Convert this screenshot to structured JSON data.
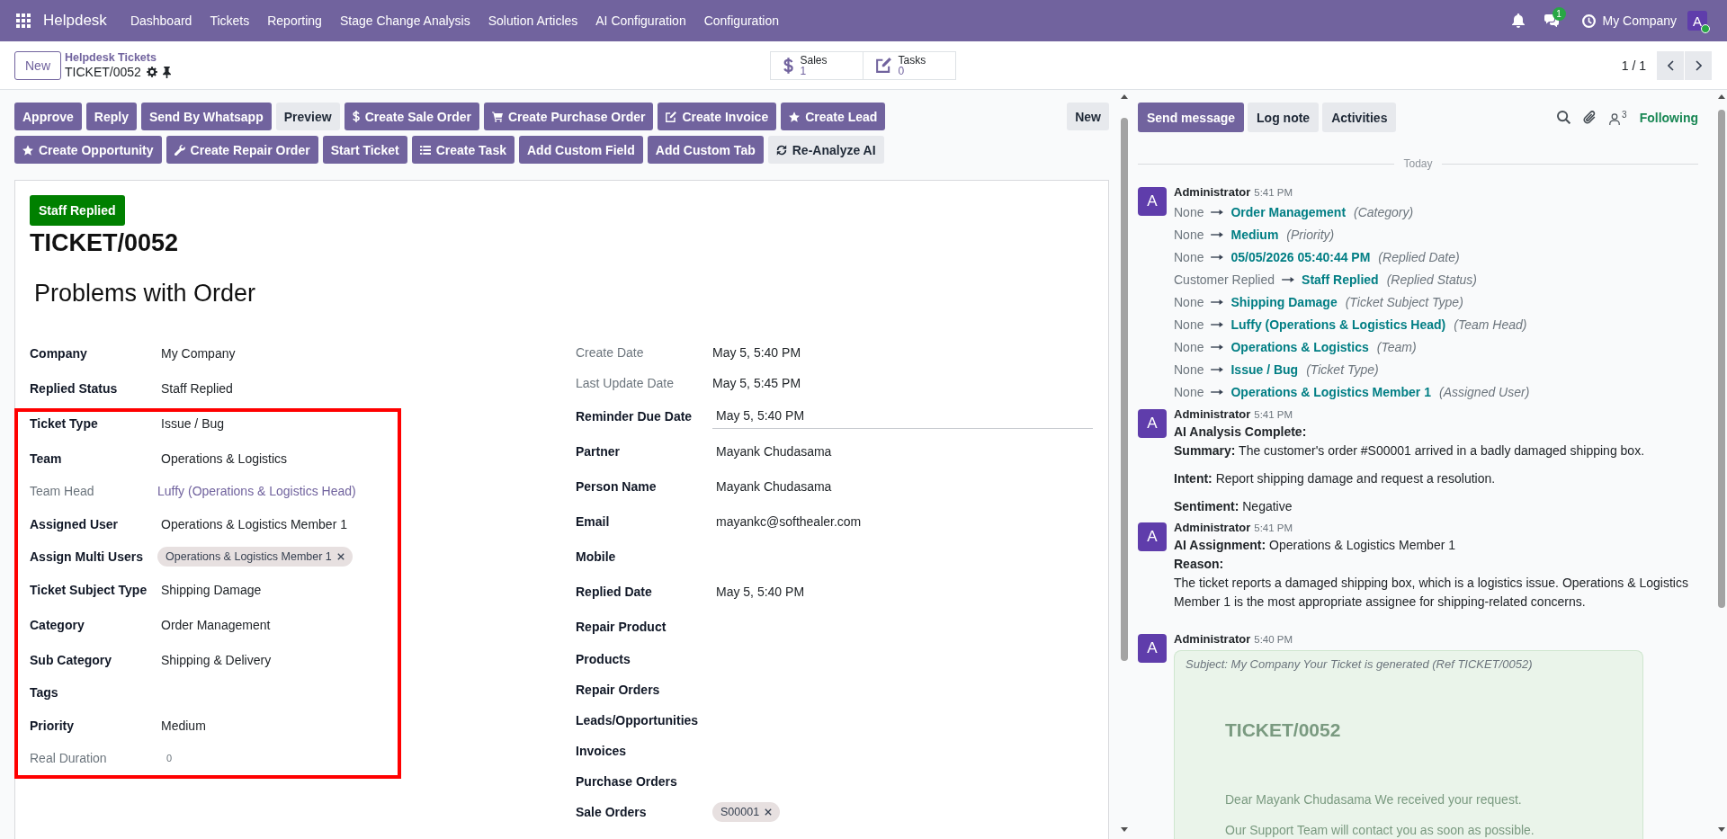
{
  "navbar": {
    "app_name": "Helpdesk",
    "menu": [
      "Dashboard",
      "Tickets",
      "Reporting",
      "Stage Change Analysis",
      "Solution Articles",
      "AI Configuration",
      "Configuration"
    ],
    "message_badge": "1",
    "company": "My Company",
    "avatar_letter": "A"
  },
  "control_panel": {
    "new_button": "New",
    "breadcrumb": "Helpdesk Tickets",
    "record_name": "TICKET/0052",
    "smart_buttons": [
      {
        "kind": "sales",
        "label": "Sales",
        "count": "1"
      },
      {
        "kind": "tasks",
        "label": "Tasks",
        "count": "0"
      }
    ],
    "pager": "1 / 1"
  },
  "action_buttons": {
    "top_row": [
      {
        "label": "Approve",
        "primary": true
      },
      {
        "label": "Reply",
        "primary": true
      },
      {
        "label": "Send By Whatsapp",
        "primary": true
      },
      {
        "label": "Preview",
        "primary": false
      },
      {
        "label": "Create Sale Order",
        "primary": true
      },
      {
        "label": "Create Purchase Order",
        "primary": true
      },
      {
        "label": "Create Invoice",
        "primary": true
      },
      {
        "label": "Create Lead",
        "primary": true
      }
    ],
    "bottom_row": [
      {
        "label": "Create Opportunity",
        "primary": true
      },
      {
        "label": "Create Repair Order",
        "primary": true
      },
      {
        "label": "Start Ticket",
        "primary": true
      },
      {
        "label": "Create Task",
        "primary": true
      },
      {
        "label": "Add Custom Field",
        "primary": true
      },
      {
        "label": "Add Custom Tab",
        "primary": true
      },
      {
        "label": "Re-Analyze AI",
        "primary": false
      }
    ],
    "side_button": {
      "label": "New",
      "primary": false
    }
  },
  "sheet": {
    "status_badge": "Staff Replied",
    "ticket_number": "TICKET/0052",
    "subject": "Problems with Order",
    "left_fields": [
      {
        "label": "Company",
        "value": "My Company",
        "kind": "text",
        "readonly": false,
        "focused": false
      },
      {
        "label": "Replied Status",
        "value": "Staff Replied",
        "kind": "text",
        "readonly": false,
        "focused": false
      }
    ],
    "highlighted_fields": [
      {
        "label": "Ticket Type",
        "value": "Issue / Bug",
        "kind": "text",
        "readonly": false,
        "focused": false
      },
      {
        "label": "Team",
        "value": "Operations & Logistics",
        "kind": "text",
        "readonly": false,
        "focused": false
      },
      {
        "label": "Team Head",
        "value": "Luffy (Operations & Logistics Head)",
        "kind": "link",
        "readonly": true,
        "focused": false
      },
      {
        "label": "Assigned User",
        "value": "Operations & Logistics Member 1",
        "kind": "text",
        "readonly": false,
        "focused": false
      },
      {
        "label": "Assign Multi Users",
        "tags": [
          "Operations & Logistics Member 1"
        ],
        "kind": "tags",
        "readonly": false,
        "focused": false
      },
      {
        "label": "Ticket Subject Type",
        "value": "Shipping Damage",
        "kind": "text",
        "readonly": false,
        "focused": false
      },
      {
        "label": "Category",
        "value": "Order Management",
        "kind": "text",
        "readonly": false,
        "focused": false
      },
      {
        "label": "Sub Category",
        "value": "Shipping & Delivery",
        "kind": "text",
        "readonly": false,
        "focused": false
      },
      {
        "label": "Tags",
        "kind": "tags",
        "readonly": false,
        "focused": false
      },
      {
        "label": "Priority",
        "value": "Medium",
        "kind": "text",
        "readonly": false,
        "focused": false
      },
      {
        "label": "Real Duration",
        "value": "0",
        "kind": "duration",
        "readonly": true,
        "focused": false
      }
    ],
    "right_fields": [
      {
        "label": "Create Date",
        "value": "May 5, 5:40 PM",
        "kind": "text",
        "readonly": true,
        "focused": false
      },
      {
        "label": "Last Update Date",
        "value": "May 5, 5:45 PM",
        "kind": "text",
        "readonly": true,
        "focused": false
      },
      {
        "label": "Reminder Due Date",
        "value": "May 5, 5:40 PM",
        "kind": "text",
        "readonly": false,
        "focused": true
      },
      {
        "label": "Partner",
        "value": "Mayank Chudasama",
        "kind": "text",
        "readonly": false,
        "focused": false
      },
      {
        "label": "Person Name",
        "value": "Mayank Chudasama",
        "kind": "text",
        "readonly": false,
        "focused": false
      },
      {
        "label": "Email",
        "value": "mayankc@softhealer.com",
        "kind": "text",
        "readonly": false,
        "focused": false
      },
      {
        "label": "Mobile",
        "kind": "text",
        "readonly": false,
        "focused": false
      },
      {
        "label": "Replied Date",
        "value": "May 5, 5:40 PM",
        "kind": "text",
        "readonly": false,
        "focused": false
      },
      {
        "label": "Repair Product",
        "kind": "text",
        "readonly": false,
        "focused": false
      },
      {
        "label": "Products",
        "kind": "tags",
        "readonly": false,
        "focused": false
      },
      {
        "label": "Repair Orders",
        "kind": "tags",
        "readonly": false,
        "focused": false
      },
      {
        "label": "Leads/Opportunities",
        "kind": "tags",
        "readonly": false,
        "focused": false
      },
      {
        "label": "Invoices",
        "kind": "tags",
        "readonly": false,
        "focused": false
      },
      {
        "label": "Purchase Orders",
        "kind": "tags",
        "readonly": false,
        "focused": false
      },
      {
        "label": "Sale Orders",
        "tags": [
          "S00001"
        ],
        "kind": "tags",
        "readonly": false,
        "focused": false
      }
    ]
  },
  "chatter": {
    "buttons": [
      {
        "label": "Send message",
        "primary": true
      },
      {
        "label": "Log note",
        "primary": false
      },
      {
        "label": "Activities",
        "primary": false
      }
    ],
    "follower_count": "3",
    "follow_label": "Following",
    "date_separator": "Today",
    "messages": [
      {
        "kind": "tracking",
        "avatar": "A",
        "author": "Administrator",
        "time": "5:41 PM",
        "changes": [
          {
            "old": "None",
            "new": "Order Management",
            "field": "(Category)"
          },
          {
            "old": "None",
            "new": "Medium",
            "field": "(Priority)"
          },
          {
            "old": "None",
            "new": "05/05/2026 05:40:44 PM",
            "field": "(Replied Date)"
          },
          {
            "old": "Customer Replied",
            "new": "Staff Replied",
            "field": "(Replied Status)"
          },
          {
            "old": "None",
            "new": "Shipping Damage",
            "field": "(Ticket Subject Type)"
          },
          {
            "old": "None",
            "new": "Luffy (Operations & Logistics Head)",
            "field": "(Team Head)"
          },
          {
            "old": "None",
            "new": "Operations & Logistics",
            "field": "(Team)"
          },
          {
            "old": "None",
            "new": "Issue / Bug",
            "field": "(Ticket Type)"
          },
          {
            "old": "None",
            "new": "Operations & Logistics Member 1",
            "field": "(Assigned User)"
          }
        ]
      },
      {
        "kind": "note",
        "avatar": "A",
        "author": "Administrator",
        "time": "5:41 PM",
        "paragraphs": [
          [
            {
              "kind": "heading",
              "text": "AI Analysis Complete:"
            },
            {
              "kind": "text",
              "text": "**Summary:** The customer's order #S00001 arrived in a badly damaged shipping box."
            }
          ],
          [
            {
              "kind": "text",
              "text": "**Intent:** Report shipping damage and request a resolution."
            }
          ],
          [
            {
              "kind": "text",
              "text": "**Sentiment:** Negative"
            }
          ]
        ]
      },
      {
        "kind": "note",
        "avatar": "A",
        "author": "Administrator",
        "time": "5:41 PM",
        "paragraphs": [
          [
            {
              "kind": "text",
              "text": "**AI Assignment:** Operations & Logistics Member 1"
            },
            {
              "kind": "heading",
              "text": "Reason:"
            },
            {
              "kind": "text",
              "text": "The ticket reports a damaged shipping box, which is a logistics issue. Operations & Logistics Member 1 is the most appropriate assignee for shipping-related concerns."
            }
          ]
        ]
      },
      {
        "kind": "email",
        "avatar": "A",
        "author": "Administrator",
        "time": "5:40 PM",
        "subject": "Subject: My Company Your Ticket is generated (Ref TICKET/0052)",
        "heading": "TICKET/0052",
        "lines": [
          "Dear Mayank Chudasama We received your request.",
          "Our Support Team will contact you as soon as possible."
        ]
      }
    ]
  }
}
